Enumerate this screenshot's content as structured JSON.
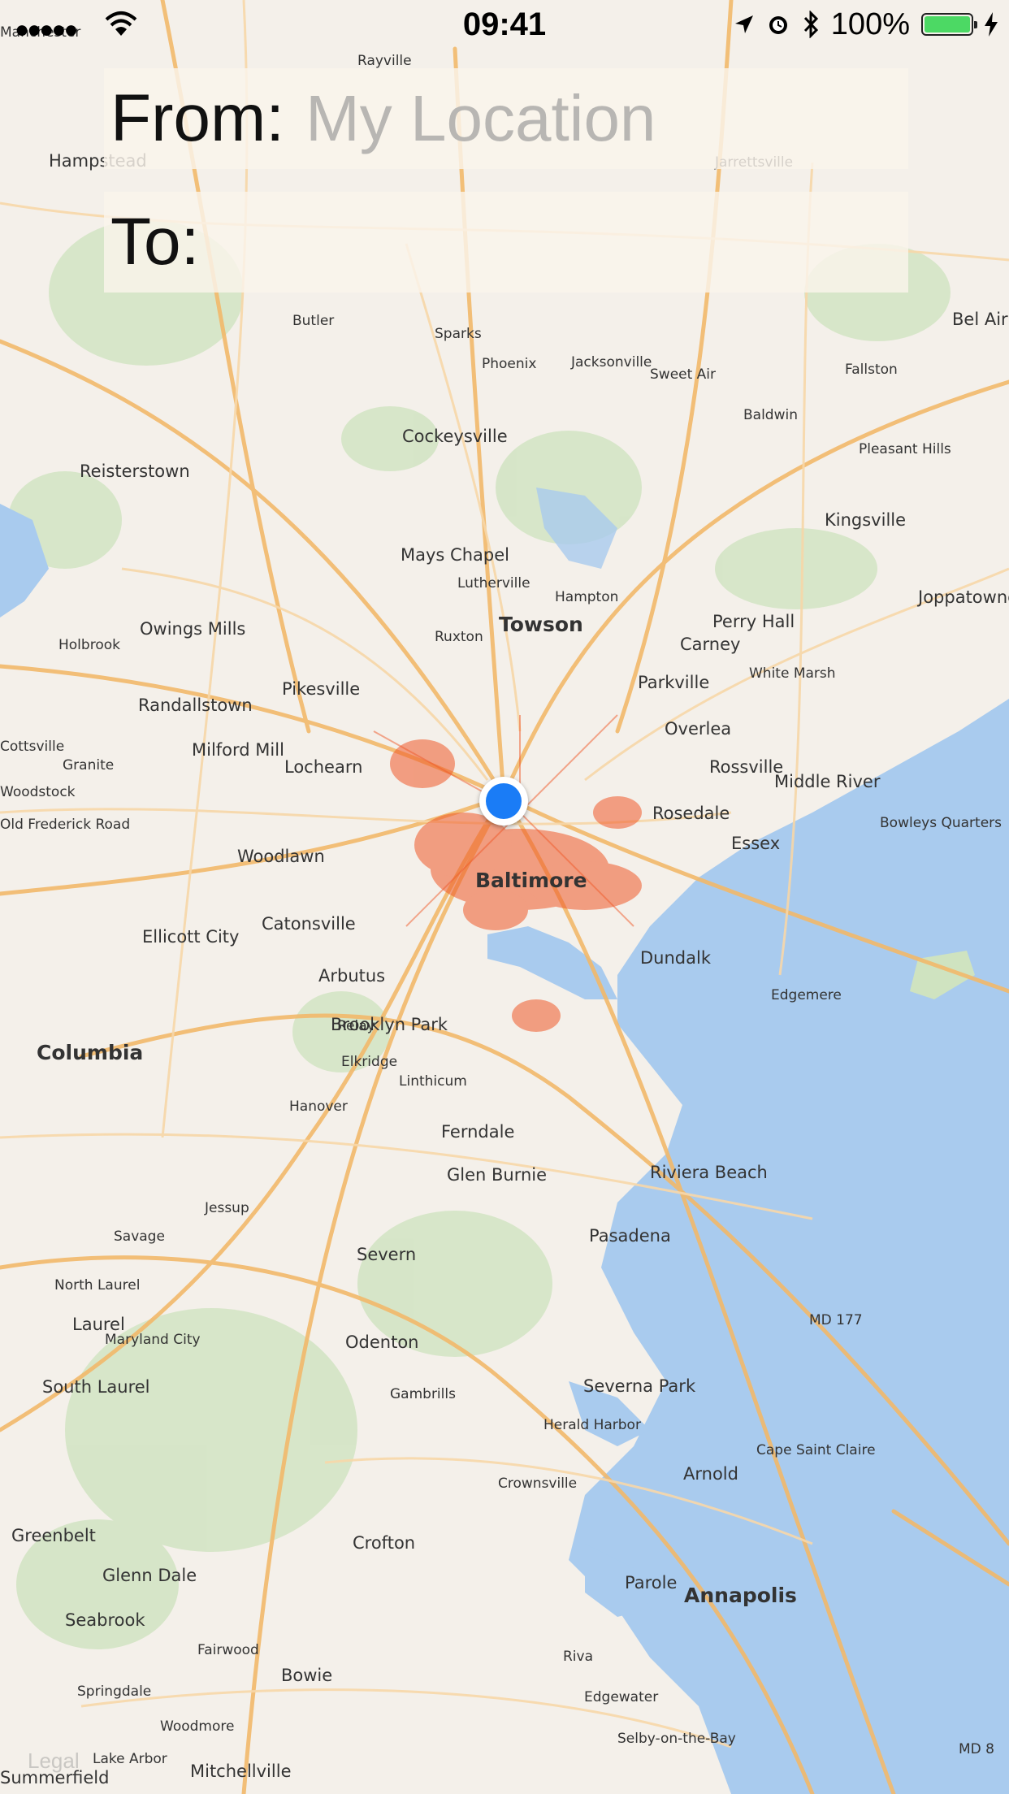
{
  "status_bar": {
    "signal": "●●●●●",
    "time": "09:41",
    "battery_percent": "100%",
    "battery_level": 1.0
  },
  "from": {
    "label": "From:",
    "placeholder": "My Location",
    "value": ""
  },
  "to": {
    "label": "To:",
    "placeholder": "",
    "value": ""
  },
  "map": {
    "legal": "Legal",
    "labels": [
      {
        "text": "Manchester",
        "size": "s"
      },
      {
        "text": "Rayville",
        "size": "s"
      },
      {
        "text": "Hampstead",
        "size": "m"
      },
      {
        "text": "Jarrettsville",
        "size": "s"
      },
      {
        "text": "Bel Air",
        "size": "m"
      },
      {
        "text": "Butler",
        "size": "s"
      },
      {
        "text": "Sparks",
        "size": "s"
      },
      {
        "text": "Phoenix",
        "size": "s"
      },
      {
        "text": "Jacksonville",
        "size": "s"
      },
      {
        "text": "Sweet Air",
        "size": "s"
      },
      {
        "text": "Fallston",
        "size": "s"
      },
      {
        "text": "Baldwin",
        "size": "s"
      },
      {
        "text": "Cockeysville",
        "size": "m"
      },
      {
        "text": "Pleasant Hills",
        "size": "s"
      },
      {
        "text": "Reisterstown",
        "size": "m"
      },
      {
        "text": "Kingsville",
        "size": "m"
      },
      {
        "text": "Mays Chapel",
        "size": "m"
      },
      {
        "text": "Lutherville",
        "size": "s"
      },
      {
        "text": "Hampton",
        "size": "s"
      },
      {
        "text": "Joppatowne",
        "size": "m"
      },
      {
        "text": "Owings Mills",
        "size": "m"
      },
      {
        "text": "Holbrook",
        "size": "s"
      },
      {
        "text": "Ruxton",
        "size": "s"
      },
      {
        "text": "Towson",
        "size": "l"
      },
      {
        "text": "Perry Hall",
        "size": "m"
      },
      {
        "text": "Carney",
        "size": "m"
      },
      {
        "text": "White Marsh",
        "size": "s"
      },
      {
        "text": "Randallstown",
        "size": "m"
      },
      {
        "text": "Pikesville",
        "size": "m"
      },
      {
        "text": "Parkville",
        "size": "m"
      },
      {
        "text": "Overlea",
        "size": "m"
      },
      {
        "text": "Cottsville",
        "size": "s"
      },
      {
        "text": "Granite",
        "size": "s"
      },
      {
        "text": "Milford Mill",
        "size": "m"
      },
      {
        "text": "Lochearn",
        "size": "m"
      },
      {
        "text": "Rossville",
        "size": "m"
      },
      {
        "text": "Middle River",
        "size": "m"
      },
      {
        "text": "Woodstock",
        "size": "s"
      },
      {
        "text": "Rosedale",
        "size": "m"
      },
      {
        "text": "Bowleys Quarters",
        "size": "s"
      },
      {
        "text": "Old Frederick Road",
        "size": "s"
      },
      {
        "text": "Woodlawn",
        "size": "m"
      },
      {
        "text": "Essex",
        "size": "m"
      },
      {
        "text": "Baltimore",
        "size": "l"
      },
      {
        "text": "Ellicott City",
        "size": "m"
      },
      {
        "text": "Catonsville",
        "size": "m"
      },
      {
        "text": "Dundalk",
        "size": "m"
      },
      {
        "text": "Arbutus",
        "size": "m"
      },
      {
        "text": "Edgemere",
        "size": "s"
      },
      {
        "text": "Relay",
        "size": "s"
      },
      {
        "text": "Brooklyn Park",
        "size": "m"
      },
      {
        "text": "Columbia",
        "size": "l"
      },
      {
        "text": "Elkridge",
        "size": "s"
      },
      {
        "text": "Linthicum",
        "size": "s"
      },
      {
        "text": "Hanover",
        "size": "s"
      },
      {
        "text": "Ferndale",
        "size": "m"
      },
      {
        "text": "Glen Burnie",
        "size": "m"
      },
      {
        "text": "Riviera Beach",
        "size": "m"
      },
      {
        "text": "Jessup",
        "size": "s"
      },
      {
        "text": "Pasadena",
        "size": "m"
      },
      {
        "text": "Savage",
        "size": "s"
      },
      {
        "text": "Severn",
        "size": "m"
      },
      {
        "text": "North Laurel",
        "size": "s"
      },
      {
        "text": "Laurel",
        "size": "m"
      },
      {
        "text": "Maryland City",
        "size": "s"
      },
      {
        "text": "Odenton",
        "size": "m"
      },
      {
        "text": "South Laurel",
        "size": "m"
      },
      {
        "text": "Severna Park",
        "size": "m"
      },
      {
        "text": "Gambrills",
        "size": "s"
      },
      {
        "text": "Herald Harbor",
        "size": "s"
      },
      {
        "text": "Cape Saint Claire",
        "size": "s"
      },
      {
        "text": "Crownsville",
        "size": "s"
      },
      {
        "text": "Arnold",
        "size": "m"
      },
      {
        "text": "Greenbelt",
        "size": "m"
      },
      {
        "text": "Crofton",
        "size": "m"
      },
      {
        "text": "Glenn Dale",
        "size": "m"
      },
      {
        "text": "Parole",
        "size": "m"
      },
      {
        "text": "Annapolis",
        "size": "l"
      },
      {
        "text": "Seabrook",
        "size": "m"
      },
      {
        "text": "Fairwood",
        "size": "s"
      },
      {
        "text": "Bowie",
        "size": "m"
      },
      {
        "text": "Riva",
        "size": "s"
      },
      {
        "text": "Springdale",
        "size": "s"
      },
      {
        "text": "Edgewater",
        "size": "s"
      },
      {
        "text": "Woodmore",
        "size": "s"
      },
      {
        "text": "Lake Arbor",
        "size": "s"
      },
      {
        "text": "Mitchellville",
        "size": "m"
      },
      {
        "text": "Selby-on-the-Bay",
        "size": "s"
      },
      {
        "text": "Summerfield",
        "size": "m"
      },
      {
        "text": "MD 177",
        "size": "s"
      },
      {
        "text": "MD 8",
        "size": "s"
      }
    ]
  }
}
